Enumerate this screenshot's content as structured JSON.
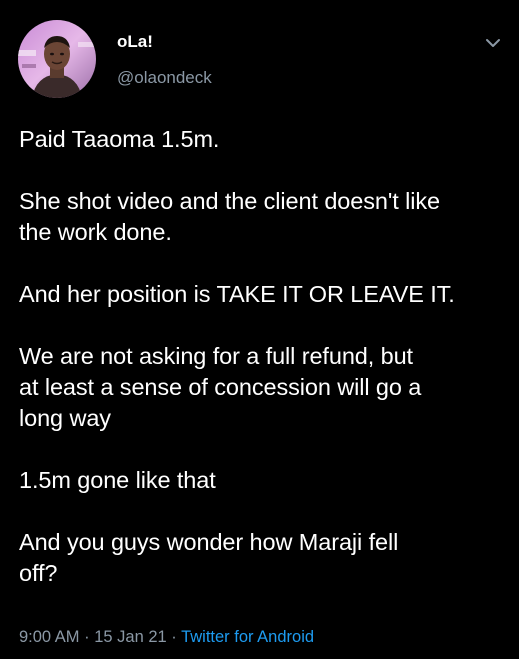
{
  "user": {
    "display_name": "oLa!",
    "handle": "@olaondeck",
    "avatar_icon": "profile-photo"
  },
  "menu": {
    "icon": "chevron-down-icon"
  },
  "tweet": {
    "paragraphs": [
      "Paid Taaoma 1.5m.",
      "She shot video and the client doesn't like\nthe work done.",
      "And her position is TAKE IT OR LEAVE IT.",
      "We are not asking for a full refund, but\nat least a sense of concession will go a\nlong way",
      "1.5m gone like that",
      "And you guys wonder how Maraji fell\noff?"
    ]
  },
  "meta": {
    "time": "9:00 AM",
    "separator": " · ",
    "date": "15 Jan 21",
    "source": "Twitter for Android"
  },
  "colors": {
    "background": "#000000",
    "text": "#ffffff",
    "secondary": "#8b98a5",
    "link": "#1d9bf0"
  }
}
